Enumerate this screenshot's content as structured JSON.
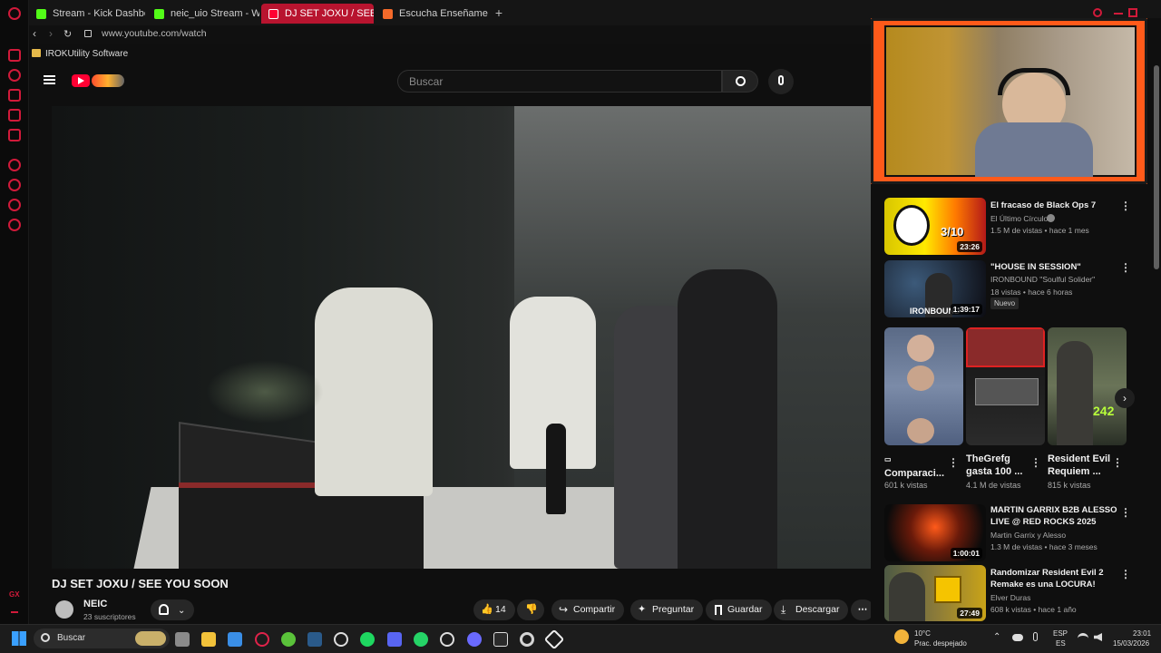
{
  "browser": {
    "tabs": [
      {
        "label": "Stream - Kick Dashboa",
        "color": "#53fc18"
      },
      {
        "label": "neic_uio Stream - Watch L",
        "color": "#53fc18"
      },
      {
        "label": "DJ SET JOXU / SEE YOU S",
        "color": "#ff0033",
        "active": true
      },
      {
        "label": "Escucha Enseñame A Baila",
        "color": "#f46a2a"
      }
    ],
    "address": "www.youtube.com/watch",
    "bookmark": "IROKUtility Software",
    "opera_badge": "GX"
  },
  "youtube": {
    "search_placeholder": "Buscar",
    "video_title": "DJ SET JOXU / SEE YOU SOON",
    "channel_name": "NEIC",
    "subscribers": "23 suscriptores",
    "likes": "14",
    "actions": {
      "share": "Compartir",
      "ask": "Preguntar",
      "save": "Guardar",
      "download": "Descargar"
    }
  },
  "recommended": [
    {
      "title": "El fracaso de Black Ops 7",
      "channel": "El Último Círculo",
      "meta": "1.5 M de vistas • hace 1 mes",
      "duration": "23:26",
      "thumb_text": "3/10"
    },
    {
      "title": "\"HOUSE IN SESSION\"",
      "channel": "IRONBOUND \"Soulful Solider\"",
      "meta": "18 vistas • hace 6 horas",
      "duration": "1:39:17",
      "badge": "Nuevo",
      "thumb_text": "IRONBOUND"
    },
    {
      "title": "MARTIN GARRIX B2B ALESSO LIVE @ RED ROCKS 2025",
      "channel": "Martin Garrix y Alesso",
      "meta": "1.3 M de vistas • hace 3 meses",
      "duration": "1:00:01"
    },
    {
      "title": "Randomizar Resident Evil 2 Remake es una LOCURA!",
      "channel": "Elver Duras",
      "meta": "608 k vistas • hace 1 año",
      "duration": "27:49"
    }
  ],
  "shorts": [
    {
      "title": "Comparaci...",
      "views": "601 k vistas",
      "prefix": "▭"
    },
    {
      "title": "TheGrefg gasta 100 ...",
      "views": "4.1 M de vistas"
    },
    {
      "title": "Resident Evil Requiem ...",
      "views": "815 k vistas",
      "thumb_text": "242"
    }
  ],
  "taskbar": {
    "search": "Buscar",
    "weather_temp": "10°C",
    "weather_desc": "Prac. despejado",
    "lang_top": "ESP",
    "lang_bottom": "ES",
    "time": "23:01",
    "date": "15/03/2026"
  }
}
